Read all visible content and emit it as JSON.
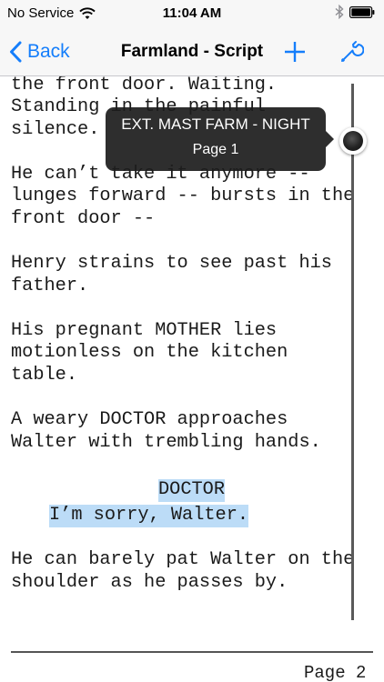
{
  "status_bar": {
    "carrier": "No Service",
    "time": "11:04 AM",
    "icons": [
      "wifi-icon",
      "bluetooth-icon",
      "battery-icon"
    ]
  },
  "nav": {
    "back_label": "Back",
    "title": "Farmland - Script",
    "add_icon": "plus-icon",
    "settings_icon": "wrench-icon",
    "accent_color": "#157efb"
  },
  "script_lines": [
    "the front door. Waiting.",
    "Standing in the painful",
    "silence.",
    "He can’t take it anymore --",
    "lunges forward -- bursts in the",
    "front door --",
    "Henry strains to see past his",
    "father.",
    "His pregnant MOTHER lies",
    "motionless on the kitchen",
    "table.",
    "A weary DOCTOR approaches",
    "Walter with trembling hands.",
    "DOCTOR",
    "I’m sorry, Walter.",
    "He can barely pat Walter on the",
    "shoulder as he passes by."
  ],
  "tooltip": {
    "scene": "EXT. MAST FARM - NIGHT",
    "page": "Page 1"
  },
  "footer": {
    "page": "Page 2"
  },
  "colors": {
    "highlight": "#bcdcf7",
    "tooltip_bg": "#1c1c1c"
  }
}
